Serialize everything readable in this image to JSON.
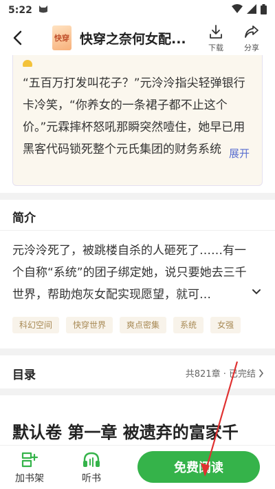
{
  "status_bar": {
    "time": "5:22"
  },
  "header": {
    "title": "快穿之奈何女配...",
    "cover_text": "快穿",
    "download_label": "下载",
    "share_label": "分享"
  },
  "quote": {
    "text": "“五百万打发叫花子？”元泠泠指尖轻弹银行卡冷笑，“你养女的一条裙子都不止这个价。”元霖摔杯怒吼那瞬突然噎住，她早已用黑客代码锁死整个元氏集团的财务系统",
    "expand_label": "展开"
  },
  "intro": {
    "title": "简介",
    "text": "元泠泠死了，被跳楼自杀的人砸死了……有一个自称“系统”的团子绑定她，说只要她去三千世界，帮助炮灰女配实现愿望，就可…",
    "tags": [
      "科幻空间",
      "快穿世界",
      "爽点密集",
      "系统",
      "女强"
    ]
  },
  "catalog": {
    "title": "目录",
    "info": "共821章 · 已完结"
  },
  "chapter": {
    "title": "默认卷 第一章 被遗弃的富家千"
  },
  "bottom_bar": {
    "bookshelf_label": "加书架",
    "listen_label": "听书",
    "read_label": "免费阅读"
  },
  "colors": {
    "accent_green": "#35b34a",
    "link_blue": "#5a6fd0",
    "annotation_red": "#e03030"
  }
}
